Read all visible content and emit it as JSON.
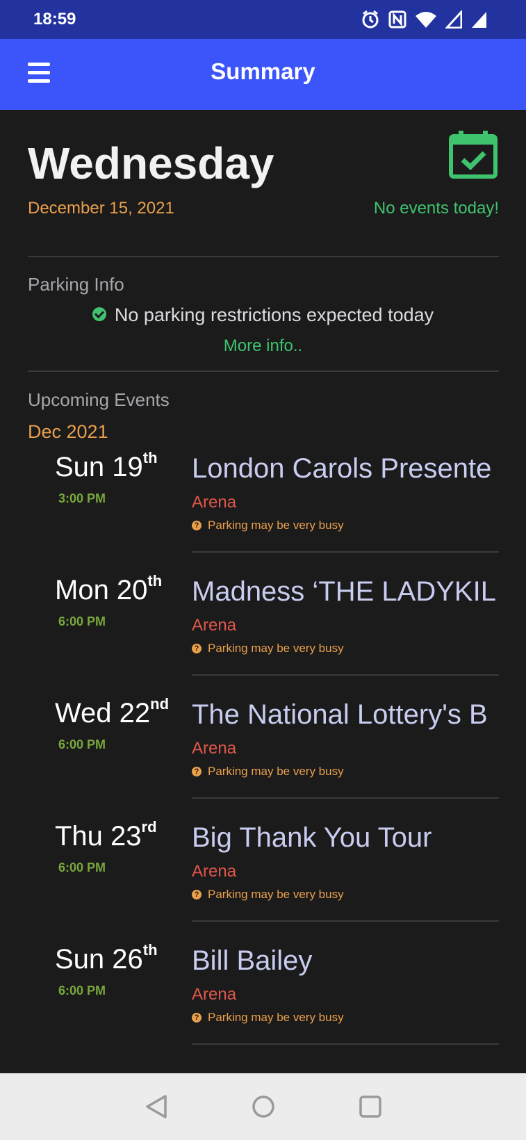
{
  "status_bar": {
    "time": "18:59",
    "icons": [
      "alarm-icon",
      "nfc-icon",
      "wifi-icon",
      "signal-icon",
      "signal-icon"
    ]
  },
  "app_bar": {
    "title": "Summary",
    "menu_icon": "hamburger-menu-icon"
  },
  "today": {
    "day": "Wednesday",
    "date": "December 15, 2021",
    "status": "No events today!",
    "status_icon": "calendar-check-icon"
  },
  "parking": {
    "label": "Parking Info",
    "message": "No parking restrictions expected today",
    "more_info": "More info.."
  },
  "upcoming": {
    "label": "Upcoming Events",
    "month": "Dec 2021",
    "events": [
      {
        "weekday_day": "Sun 19",
        "suffix": "th",
        "time": "3:00 PM",
        "title": "London Carols Presente",
        "venue": "Arena",
        "parking": "Parking may be very busy"
      },
      {
        "weekday_day": "Mon 20",
        "suffix": "th",
        "time": "6:00 PM",
        "title": "Madness ‘THE LADYKIL",
        "venue": "Arena",
        "parking": "Parking may be very busy"
      },
      {
        "weekday_day": "Wed 22",
        "suffix": "nd",
        "time": "6:00 PM",
        "title": "The National Lottery's B",
        "venue": "Arena",
        "parking": "Parking may be very busy"
      },
      {
        "weekday_day": "Thu 23",
        "suffix": "rd",
        "time": "6:00 PM",
        "title": "Big Thank You Tour",
        "venue": "Arena",
        "parking": "Parking may be very busy"
      },
      {
        "weekday_day": "Sun 26",
        "suffix": "th",
        "time": "6:00 PM",
        "title": "Bill Bailey",
        "venue": "Arena",
        "parking": "Parking may be very busy"
      }
    ]
  },
  "colors": {
    "status_bar": "#2233a0",
    "app_bar": "#3b55fb",
    "background": "#1b1b1c",
    "accent_orange": "#eaa04a",
    "accent_green": "#3fc36e",
    "venue_red": "#e0574a",
    "title_lavender": "#c8cdf0",
    "time_green": "#79a83b"
  }
}
